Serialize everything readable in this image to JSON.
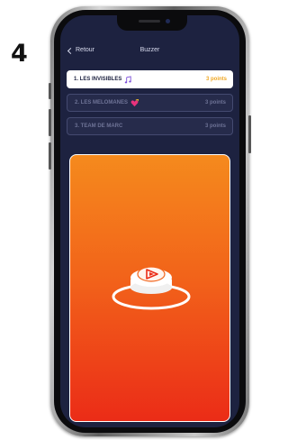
{
  "step_number": "4",
  "nav": {
    "back_label": "Retour",
    "title": "Buzzer"
  },
  "teams": [
    {
      "name": "1. LES INVISIBLES",
      "points": "3 points",
      "emoji": "musical-notes-icon",
      "selected": true
    },
    {
      "name": "2. LES MELOMANES",
      "points": "3 points",
      "emoji": "heart-ribbon-icon",
      "selected": false
    },
    {
      "name": "3. TEAM DE MARC",
      "points": "3 points",
      "emoji": "",
      "selected": false
    }
  ],
  "buzzer": {
    "icon": "buzzer-button-icon",
    "logo_icon": "play-logo-icon"
  },
  "colors": {
    "app_background": "#1d2240",
    "active_row": "#ffffff",
    "points_highlight": "#f0a825",
    "buzzer_gradient_top": "#f58a1d",
    "buzzer_gradient_bottom": "#eb2c17"
  }
}
